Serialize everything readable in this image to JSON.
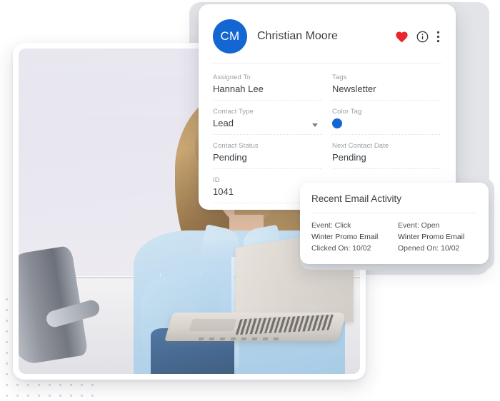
{
  "contact_card": {
    "avatar_initials": "CM",
    "name": "Christian Moore",
    "accent_color": "#1466d2",
    "actions": [
      {
        "name": "favorite-heart-icon",
        "label": "Favorite",
        "color": "#e8262b"
      },
      {
        "name": "info-icon",
        "label": "Info",
        "color": "#3c4043"
      },
      {
        "name": "more-options-icon",
        "label": "More options",
        "color": "#3c4043"
      }
    ],
    "fields": [
      {
        "label": "Assigned To",
        "value": "Hannah Lee",
        "type": "text"
      },
      {
        "label": "Tags",
        "value": "Newsletter",
        "type": "text"
      },
      {
        "label": "Contact Type",
        "value": "Lead",
        "type": "dropdown"
      },
      {
        "label": "Color Tag",
        "value": "",
        "type": "color",
        "color": "#1466d2"
      },
      {
        "label": "Contact Status",
        "value": "Pending",
        "type": "text"
      },
      {
        "label": "Next Contact Date",
        "value": "Pending",
        "type": "text"
      },
      {
        "label": "ID",
        "value": "1041",
        "type": "text"
      }
    ]
  },
  "email_card": {
    "title": "Recent Email Activity",
    "columns": [
      {
        "event": "Event: Click",
        "subject": "Winter Promo Email",
        "date": "Clicked On: 10/02"
      },
      {
        "event": "Event: Open",
        "subject": "Winter Promo Email",
        "date": "Opened On: 10/02"
      }
    ]
  },
  "photo_card": {
    "alt": "Woman in light blue shirt working on a silver laptop at a white desk"
  }
}
